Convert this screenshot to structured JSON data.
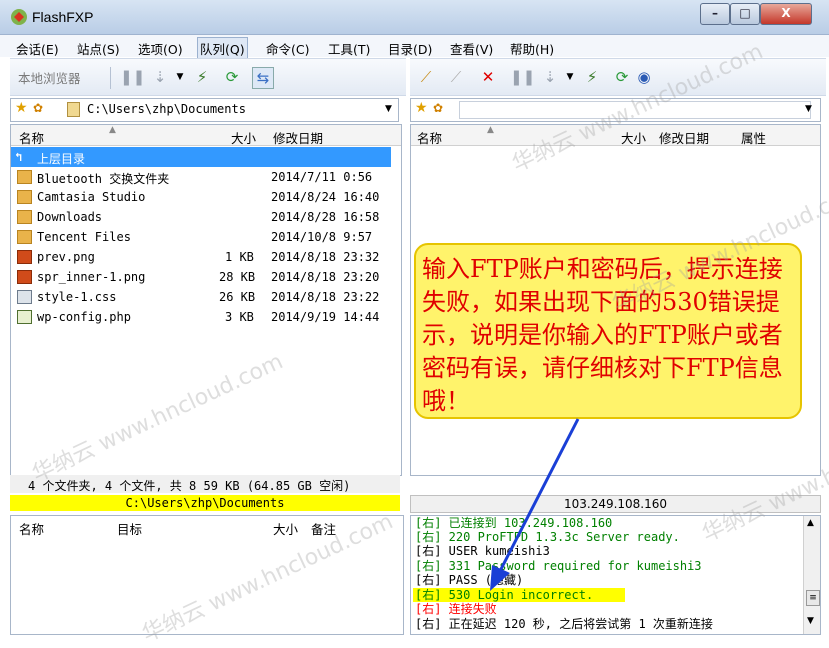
{
  "window": {
    "title": "FlashFXP",
    "min": "–",
    "max": "□",
    "close": "X"
  },
  "menu": [
    "会话(E)",
    "站点(S)",
    "选项(O)",
    "队列(Q)",
    "命令(C)",
    "工具(T)",
    "目录(D)",
    "查看(V)",
    "帮助(H)"
  ],
  "left_toolbar": {
    "local_browser": "本地浏览器"
  },
  "left_address": {
    "path": "C:\\Users\\zhp\\Documents",
    "dropdown": "▼"
  },
  "right_address": {
    "path": "",
    "dropdown": "▼"
  },
  "left_columns": {
    "name": "名称",
    "size": "大小",
    "date": "修改日期"
  },
  "right_columns": {
    "name": "名称",
    "size": "大小",
    "date": "修改日期",
    "attr": "属性"
  },
  "files": [
    {
      "name": "上层目录",
      "size": "",
      "date": "",
      "type": "up"
    },
    {
      "name": "Bluetooth 交换文件夹",
      "size": "",
      "date": "2014/7/11 0:56",
      "type": "folder"
    },
    {
      "name": "Camtasia Studio",
      "size": "",
      "date": "2014/8/24 16:40",
      "type": "folder"
    },
    {
      "name": "Downloads",
      "size": "",
      "date": "2014/8/28 16:58",
      "type": "folder"
    },
    {
      "name": "Tencent Files",
      "size": "",
      "date": "2014/10/8 9:57",
      "type": "folder"
    },
    {
      "name": "prev.png",
      "size": "1 KB",
      "date": "2014/8/18 23:32",
      "type": "png"
    },
    {
      "name": "spr_inner-1.png",
      "size": "28 KB",
      "date": "2014/8/18 23:20",
      "type": "png"
    },
    {
      "name": "style-1.css",
      "size": "26 KB",
      "date": "2014/8/18 23:22",
      "type": "css"
    },
    {
      "name": "wp-config.php",
      "size": "3 KB",
      "date": "2014/9/19 14:44",
      "type": "php"
    }
  ],
  "left_status": "4 个文件夹, 4 个文件, 共 8 59 KB (64.85 GB 空闲)",
  "left_path_bar": "C:\\Users\\zhp\\Documents",
  "right_path_bar": "103.249.108.160",
  "queue_columns": {
    "name": "名称",
    "target": "目标",
    "size": "大小",
    "note": "备注"
  },
  "log": [
    {
      "text": "[右] 已连接到 103.249.108.160",
      "color": "#008000"
    },
    {
      "text": "[右] 220 ProFTPD 1.3.3c Server ready.",
      "color": "#008000"
    },
    {
      "text": "[右] USER kumeishi3",
      "color": "#000000"
    },
    {
      "text": "[右] 331 Password required for kumeishi3",
      "color": "#008000"
    },
    {
      "text": "[右] PASS (隐藏)",
      "color": "#000000"
    },
    {
      "text": "[右] 530 Login incorrect.",
      "color": "#008000"
    },
    {
      "text": "[右] 连接失败",
      "color": "#ff0000"
    },
    {
      "text": "[右] 正在延迟 120 秒, 之后将尝试第 1 次重新连接",
      "color": "#000000"
    }
  ],
  "annotation": "输入FTP账户和密码后，提示连接失败，如果出现下面的530错误提示，说明是你输入的FTP账户或者密码有误，请仔细核对下FTP信息哦！",
  "watermark": "华纳云 www.hncloud.com",
  "colors": {
    "highlight": "#ffff00",
    "selection": "#3399ff",
    "annotation_bg": "#fff36b",
    "annotation_text": "#e00000",
    "arrow": "#1a3fd6"
  }
}
